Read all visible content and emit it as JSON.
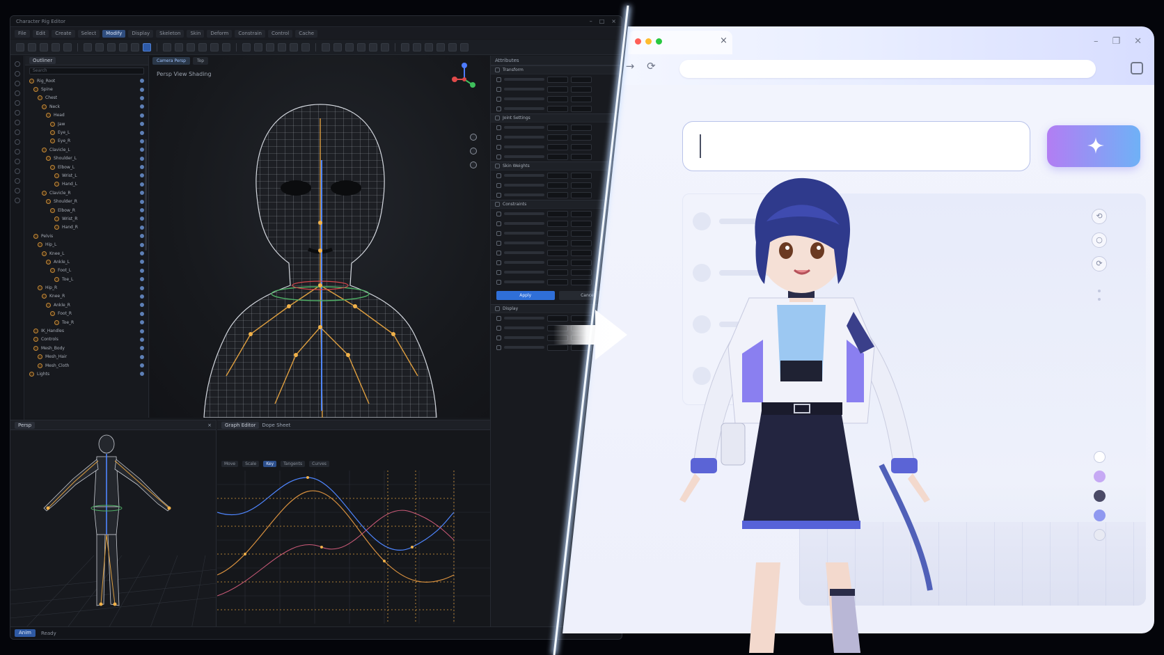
{
  "editor": {
    "title": "Character Rig Editor",
    "menus": [
      "File",
      "Edit",
      "Create",
      "Select",
      "Modify",
      "Display",
      "Skeleton",
      "Skin",
      "Deform",
      "Constrain",
      "Control",
      "Cache"
    ],
    "active_menu_index": 4,
    "outliner": {
      "tab": "Outliner",
      "search_placeholder": "Search",
      "rows": [
        "Rig_Root",
        "Spine",
        "Chest",
        "Neck",
        "Head",
        "Jaw",
        "Eye_L",
        "Eye_R",
        "Clavicle_L",
        "Shoulder_L",
        "Elbow_L",
        "Wrist_L",
        "Hand_L",
        "Clavicle_R",
        "Shoulder_R",
        "Elbow_R",
        "Wrist_R",
        "Hand_R",
        "Pelvis",
        "Hip_L",
        "Knee_L",
        "Ankle_L",
        "Foot_L",
        "Toe_L",
        "Hip_R",
        "Knee_R",
        "Ankle_R",
        "Foot_R",
        "Toe_R",
        "IK_Handles",
        "Controls",
        "Mesh_Body",
        "Mesh_Hair",
        "Mesh_Cloth",
        "Lights"
      ]
    },
    "viewport": {
      "tabs": [
        "Camera Persp",
        "Top"
      ],
      "breadcrumb": "Persp  View  Shading"
    },
    "properties": {
      "header": "Attributes",
      "sections": [
        "Transform",
        "Joint Settings",
        "Skin Weights",
        "Constraints",
        "Display"
      ],
      "buttons": {
        "primary": "Apply",
        "secondary": "Cancel"
      }
    },
    "mini_viewport": {
      "tab": "Persp"
    },
    "graph": {
      "tabs": [
        "Graph Editor",
        "Dope Sheet"
      ],
      "tools": [
        "Move",
        "Scale",
        "Key",
        "Tangents",
        "Curves"
      ]
    },
    "status": {
      "mode": "Anim",
      "text": "Ready"
    }
  },
  "browser": {
    "tab_close": "×",
    "win_controls": [
      "–",
      "❐",
      "✕"
    ],
    "nav": [
      "←",
      "→",
      "⟳"
    ],
    "url_value": "",
    "prompt_value": "",
    "generate_icon": "sparkle-icon",
    "sidebar_items": 4,
    "preview_tools": [
      "rotate-icon",
      "circle-icon",
      "refresh-icon"
    ],
    "swatches": [
      "#ffffff",
      "#c6a9f4",
      "#4a4a66",
      "#8f98f0",
      "#e8eaf3"
    ]
  },
  "colors": {
    "accent_blue": "#2f6fd8",
    "generate_gradient": [
      "#b27df3",
      "#6fb1f6"
    ],
    "divider_glow": "#cfe4ff"
  }
}
